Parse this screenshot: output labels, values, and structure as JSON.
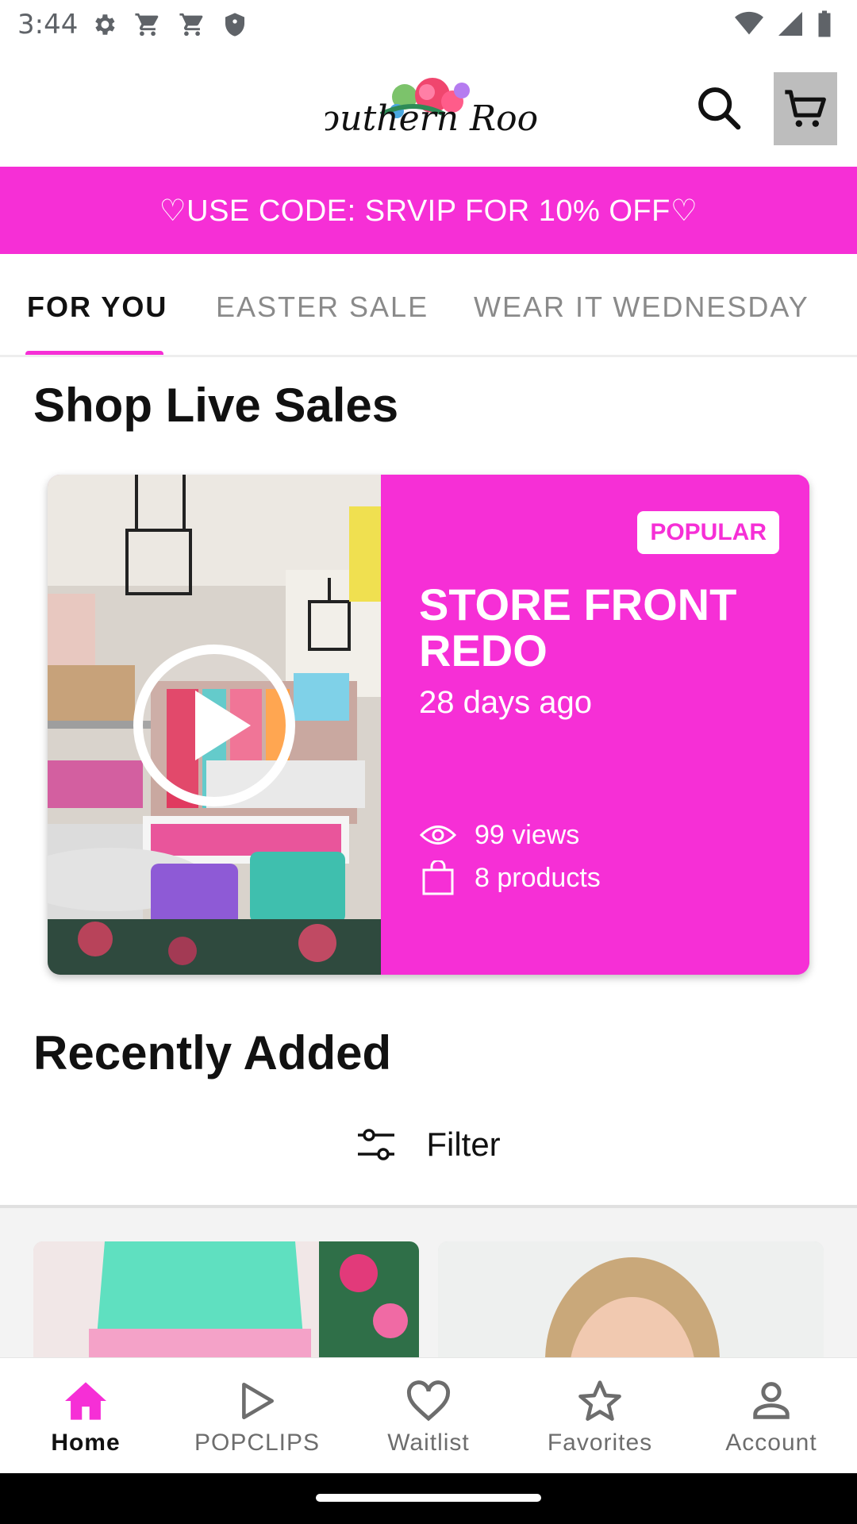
{
  "status_bar": {
    "time": "3:44",
    "left_icons": [
      "gear-icon",
      "cart-icon",
      "cart-icon",
      "shield-icon"
    ],
    "right_icons": [
      "wifi-icon",
      "signal-icon",
      "battery-icon"
    ]
  },
  "header": {
    "logo_text": "Southern Roots",
    "search_icon": "search-icon",
    "cart_icon": "cart-icon"
  },
  "promo": {
    "text": "♡USE CODE: SRVIP FOR 10% OFF♡",
    "color": "#f62fd6"
  },
  "tabs": [
    {
      "label": "FOR YOU",
      "active": true
    },
    {
      "label": "EASTER SALE",
      "active": false
    },
    {
      "label": "WEAR IT WEDNESDAY",
      "active": false
    }
  ],
  "sections": {
    "live_sales_title": "Shop Live Sales",
    "recently_added_title": "Recently Added"
  },
  "live_card": {
    "badge": "POPULAR",
    "title": "STORE FRONT REDO",
    "date": "28 days ago",
    "views": "99 views",
    "products": "8 products",
    "play_icon": "play-icon"
  },
  "filter": {
    "label": "Filter",
    "icon": "sliders-icon"
  },
  "bottom_nav": [
    {
      "label": "Home",
      "icon": "home-icon",
      "active": true
    },
    {
      "label": "POPCLIPS",
      "icon": "play-outline-icon",
      "active": false
    },
    {
      "label": "Waitlist",
      "icon": "heart-icon",
      "active": false
    },
    {
      "label": "Favorites",
      "icon": "star-icon",
      "active": false
    },
    {
      "label": "Account",
      "icon": "person-icon",
      "active": false
    }
  ],
  "colors": {
    "accent": "#f62fd6",
    "text_dark": "#111111",
    "text_muted": "#8a8a8a"
  }
}
